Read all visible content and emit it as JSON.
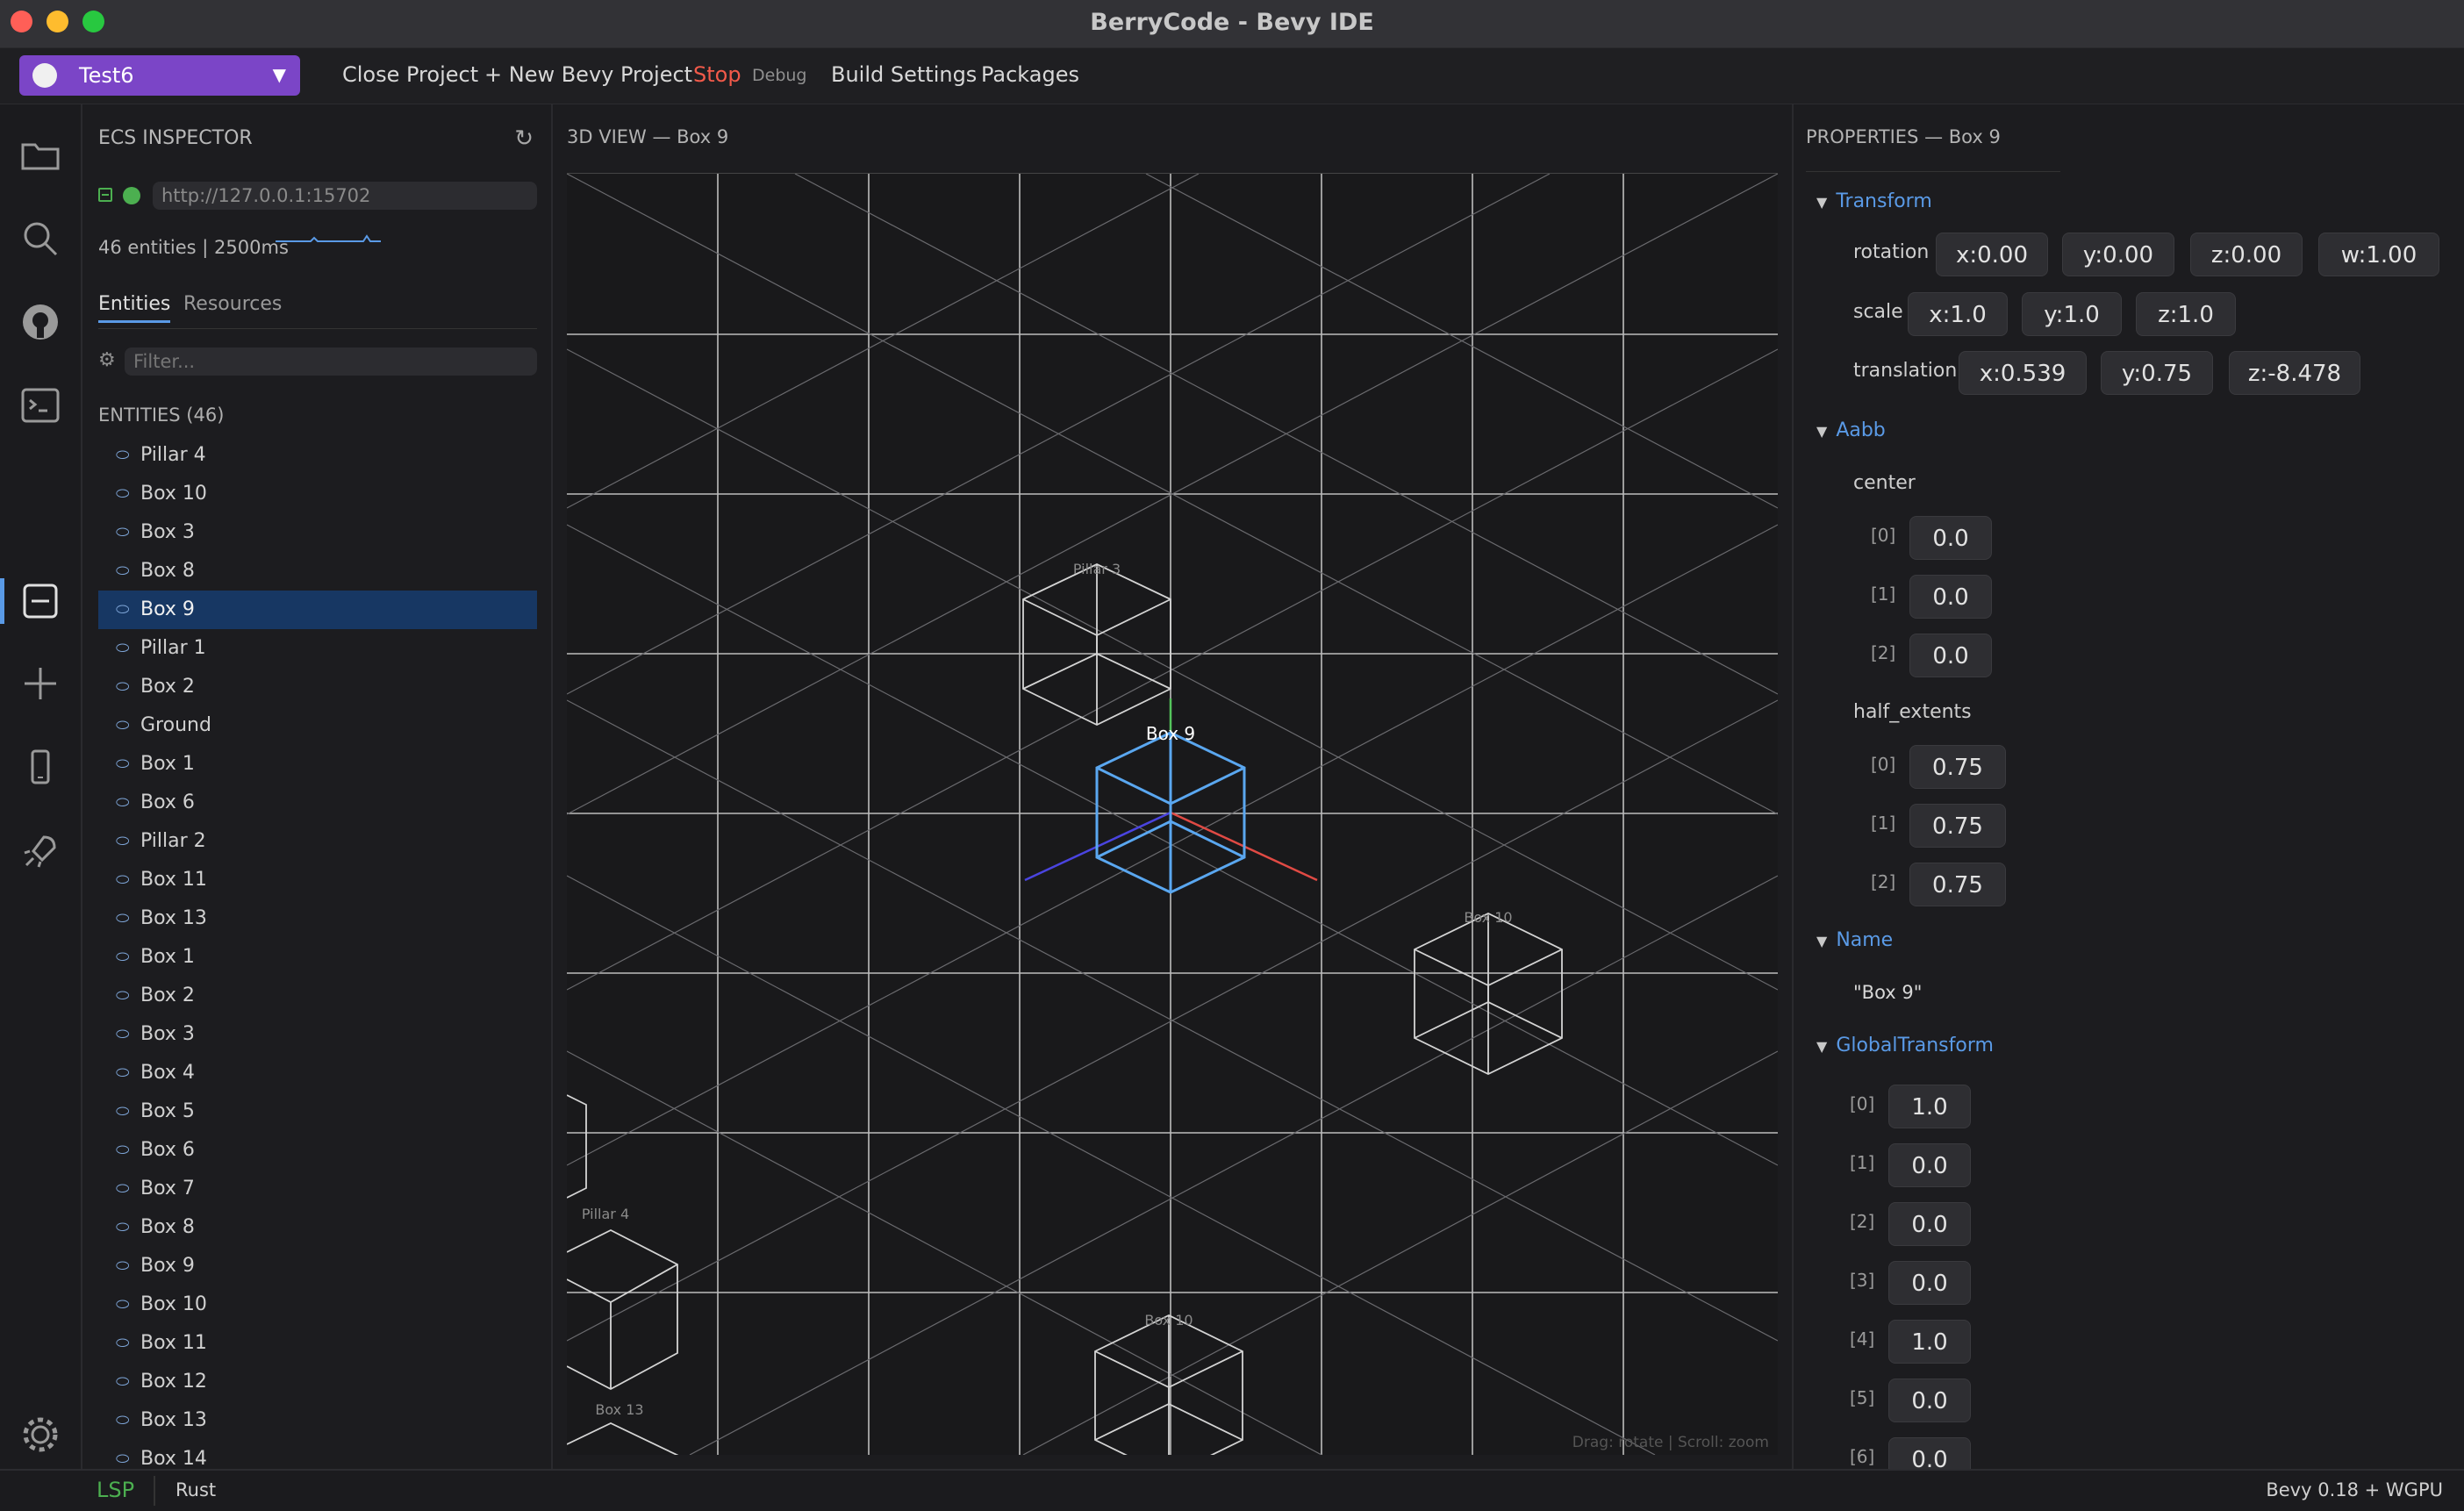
{
  "window": {
    "title": "BerryCode - Bevy IDE"
  },
  "menubar": {
    "project_name": "Test6",
    "close_project": "Close Project",
    "new_project": "+ New Bevy Project",
    "stop": "Stop",
    "debug": "Debug",
    "build_settings": "Build Settings",
    "packages": "Packages"
  },
  "activity": {
    "icons": [
      "folder-icon",
      "search-icon",
      "github-icon",
      "terminal-icon",
      "ecs-inspector-icon",
      "add-icon",
      "mobile-icon",
      "rocket-icon",
      "settings-icon"
    ],
    "active": "ecs-inspector-icon"
  },
  "inspector": {
    "title": "ECS INSPECTOR",
    "url": "http://127.0.0.1:15702",
    "stats": "46 entities | 2500ms",
    "tabs": [
      "Entities",
      "Resources"
    ],
    "active_tab": "Entities",
    "filter_placeholder": "Filter...",
    "entities_header": "ENTITIES (46)",
    "entities": [
      "Pillar 4",
      "Box 10",
      "Box 3",
      "Box 8",
      "Box 9",
      "Pillar 1",
      "Box 2",
      "Ground",
      "Box 1",
      "Box 6",
      "Pillar 2",
      "Box 11",
      "Box 13",
      "Box 1",
      "Box 2",
      "Box 3",
      "Box 4",
      "Box 5",
      "Box 6",
      "Box 7",
      "Box 8",
      "Box 9",
      "Box 10",
      "Box 11",
      "Box 12",
      "Box 13",
      "Box 14"
    ],
    "selected": "Box 9"
  },
  "view3d": {
    "title": "3D VIEW — Box 9",
    "labels": {
      "selected": "Box 9",
      "pillar3": "Pillar 3",
      "box10a": "Box 10",
      "pillar4": "Pillar 4",
      "box10b": "Box 10",
      "box13": "Box 13"
    },
    "hint": "Drag: rotate | Scroll: zoom"
  },
  "properties": {
    "title": "PROPERTIES — Box 9",
    "transform": {
      "label": "Transform",
      "rotation_label": "rotation",
      "rotation": [
        "x:0.00",
        "y:0.00",
        "z:0.00",
        "w:1.00"
      ],
      "scale_label": "scale",
      "scale": [
        "x:1.0",
        "y:1.0",
        "z:1.0"
      ],
      "translation_label": "translation",
      "translation": [
        "x:0.539",
        "y:0.75",
        "z:-8.478"
      ]
    },
    "aabb": {
      "label": "Aabb",
      "center_label": "center",
      "center": [
        "0.0",
        "0.0",
        "0.0"
      ],
      "half_extents_label": "half_extents",
      "half_extents": [
        "0.75",
        "0.75",
        "0.75"
      ],
      "indices": [
        "[0]",
        "[1]",
        "[2]"
      ]
    },
    "name": {
      "label": "Name",
      "value": "\"Box 9\""
    },
    "global_transform": {
      "label": "GlobalTransform",
      "indices": [
        "[0]",
        "[1]",
        "[2]",
        "[3]",
        "[4]",
        "[5]",
        "[6]"
      ],
      "values": [
        "1.0",
        "0.0",
        "0.0",
        "0.0",
        "1.0",
        "0.0",
        "0.0"
      ]
    }
  },
  "statusbar": {
    "lsp": "LSP",
    "language": "Rust",
    "engine": "Bevy 0.18 + WGPU"
  },
  "colors": {
    "accent": "#5a9ae6",
    "project": "#7b45c7",
    "stop": "#f25a4a",
    "ok": "#4caf50",
    "selection": "#173763"
  }
}
